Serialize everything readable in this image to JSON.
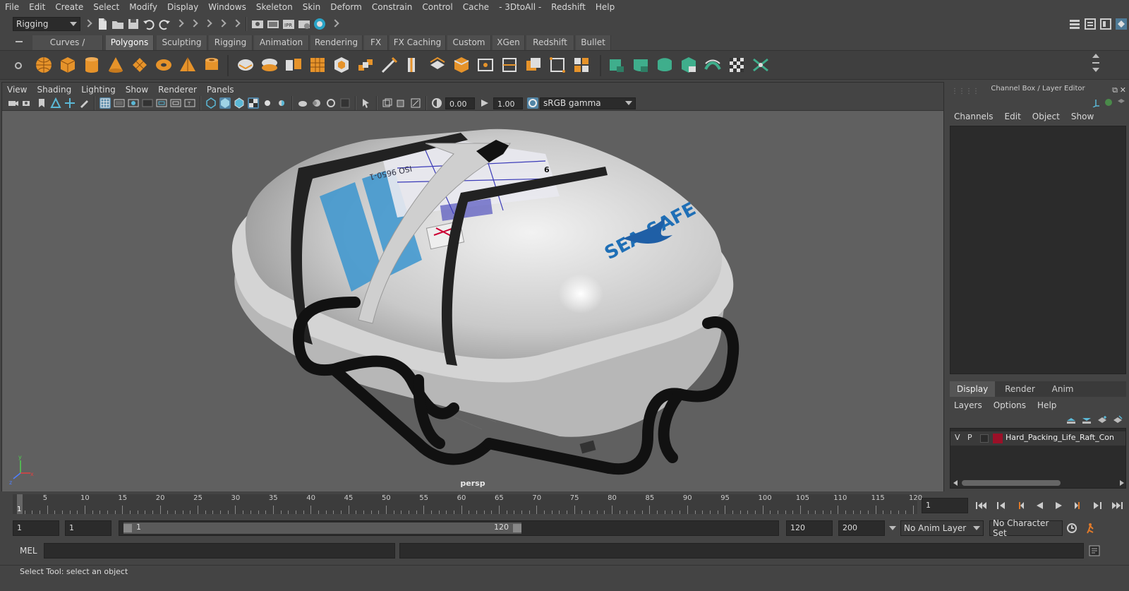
{
  "menubar": {
    "items": [
      "File",
      "Edit",
      "Create",
      "Select",
      "Modify",
      "Display",
      "Windows",
      "Skeleton",
      "Skin",
      "Deform",
      "Constrain",
      "Control",
      "Cache",
      "- 3DtoAll -",
      "Redshift",
      "Help"
    ]
  },
  "statusline": {
    "mode_selector": "Rigging"
  },
  "shelf": {
    "tabs": [
      "Curves / Surfaces",
      "Polygons",
      "Sculpting",
      "Rigging",
      "Animation",
      "Rendering",
      "FX",
      "FX Caching",
      "Custom",
      "XGen",
      "Redshift",
      "Bullet"
    ],
    "active_tab": "Polygons"
  },
  "viewport": {
    "menus": [
      "View",
      "Shading",
      "Lighting",
      "Show",
      "Renderer",
      "Panels"
    ],
    "exposure": "0.00",
    "gamma": "1.00",
    "color_space": "sRGB gamma",
    "camera_label": "persp",
    "model_text": {
      "brand": "SEA-SAFE",
      "iso": "ISO 9650-1",
      "number": "6"
    }
  },
  "channel_box": {
    "title": "Channel Box / Layer Editor",
    "menus": [
      "Channels",
      "Edit",
      "Object",
      "Show"
    ]
  },
  "layer_editor": {
    "tabs": [
      "Display",
      "Render",
      "Anim"
    ],
    "active_tab": "Display",
    "menus": [
      "Layers",
      "Options",
      "Help"
    ],
    "layers": [
      {
        "visible": "V",
        "playback": "P",
        "name": "Hard_Packing_Life_Raft_Con",
        "color": "#9b1028"
      }
    ]
  },
  "timeslider": {
    "ticks": [
      "1",
      "5",
      "10",
      "15",
      "20",
      "25",
      "30",
      "35",
      "40",
      "45",
      "50",
      "55",
      "60",
      "65",
      "70",
      "75",
      "80",
      "85",
      "90",
      "95",
      "100",
      "105",
      "110",
      "115",
      "120"
    ],
    "current_frame": "1"
  },
  "range": {
    "start": "1",
    "playback_start": "1",
    "slider_start": "1",
    "slider_end": "120",
    "playback_end": "120",
    "end": "200",
    "anim_layer": "No Anim Layer",
    "character_set": "No Character Set"
  },
  "cmdline": {
    "label": "MEL"
  },
  "helpline": {
    "text": "Select Tool: select an object"
  }
}
